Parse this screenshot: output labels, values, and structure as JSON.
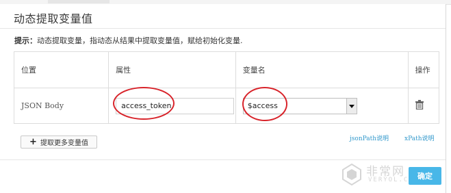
{
  "dialog": {
    "title": "动态提取变量值",
    "hint_label": "提示：",
    "hint_text": "动态提取变量，指动态从结果中提取变量值，赋给初始化变量."
  },
  "table": {
    "headers": {
      "position": "位置",
      "attribute": "属性",
      "variable_name": "变量名",
      "operation": "操作"
    },
    "rows": [
      {
        "position": "JSON Body",
        "attribute": "access_token",
        "variable_name": "$access",
        "delete_icon": "trash-icon"
      }
    ]
  },
  "actions": {
    "add_more_label": "提取更多变量值",
    "add_icon": "plus-icon",
    "jsonpath_link": "jsonPath说明",
    "xpath_link": "xPath说明",
    "confirm_label": "确定"
  },
  "watermark": {
    "cn": "非常网",
    "en": "VERYOL.COM"
  },
  "colors": {
    "accent": "#48b7e8",
    "link": "#3399cc",
    "annotation": "#d8232a"
  }
}
